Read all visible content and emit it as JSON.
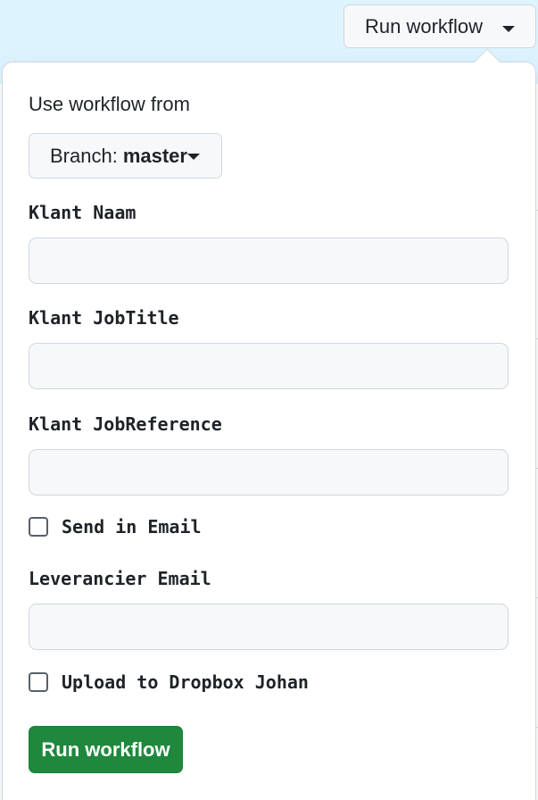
{
  "header": {
    "run_workflow_label": "Run workflow"
  },
  "form": {
    "heading": "Use workflow from",
    "branch": {
      "prefix": "Branch:",
      "name": "master"
    },
    "fields": [
      {
        "label": "Klant Naam",
        "value": ""
      },
      {
        "label": "Klant JobTitle",
        "value": ""
      },
      {
        "label": "Klant JobReference",
        "value": ""
      }
    ],
    "send_email": {
      "label": "Send in Email",
      "checked": false
    },
    "supplier_email": {
      "label": "Leverancier Email",
      "value": ""
    },
    "upload_dropbox": {
      "label": "Upload to Dropbox Johan",
      "checked": false
    },
    "submit_label": "Run workflow"
  },
  "colors": {
    "primary": "#1f883d",
    "highlight_bg": "#ddf4ff",
    "border": "#d0d7de"
  }
}
